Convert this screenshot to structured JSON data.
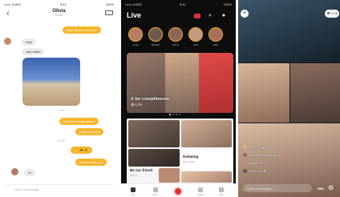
{
  "chat": {
    "status": {
      "carrier": "•••••• VUBO",
      "time": "9:41",
      "battery": "100%"
    },
    "contact_name": "Olivia",
    "contact_sub": "Online",
    "messages": {
      "m1": "Hey! Where are you?",
      "m2": "Hey!",
      "m3": "Just chillin",
      "m4": "Welcome to paradise!",
      "m5": "Enjoy yourself",
      "m6": "🙌 😎 🌴",
      "m7": "Gonna miss you"
    },
    "timestamps": {
      "t1": "12:30",
      "t2": "12:35"
    },
    "more": "•••",
    "input_placeholder": "Send a message..."
  },
  "live": {
    "status": {
      "carrier": "•••••• VUBO",
      "time": "9:41",
      "battery": "100%"
    },
    "title": "Live",
    "stories": [
      "Annie",
      "Michael",
      "Alexis",
      "Jake",
      "Katie"
    ],
    "feature_caption": "X for compliments",
    "feature_count": "👁 1,378",
    "tiles": {
      "debate": "Debating",
      "debate_sub": "Who wins?",
      "friend": "Be our friend",
      "friend_sub": "Join us"
    },
    "tabs": [
      "Live",
      "Chat",
      "",
      "Feed",
      "Me"
    ]
  },
  "video": {
    "viewer_count": "👁 4.2K",
    "comments": [
      {
        "name": "Chloe",
        "text": "Chloe  hey girls!"
      },
      {
        "name": "Mia",
        "text": "Mia  I like your glasses!"
      },
      {
        "name": "Hannah",
        "text": "Hannah  hi"
      },
      {
        "name": "Ella",
        "text": "Ella  so cute ❤"
      }
    ],
    "input_placeholder": "Send a message...",
    "rec_label": "REC"
  }
}
